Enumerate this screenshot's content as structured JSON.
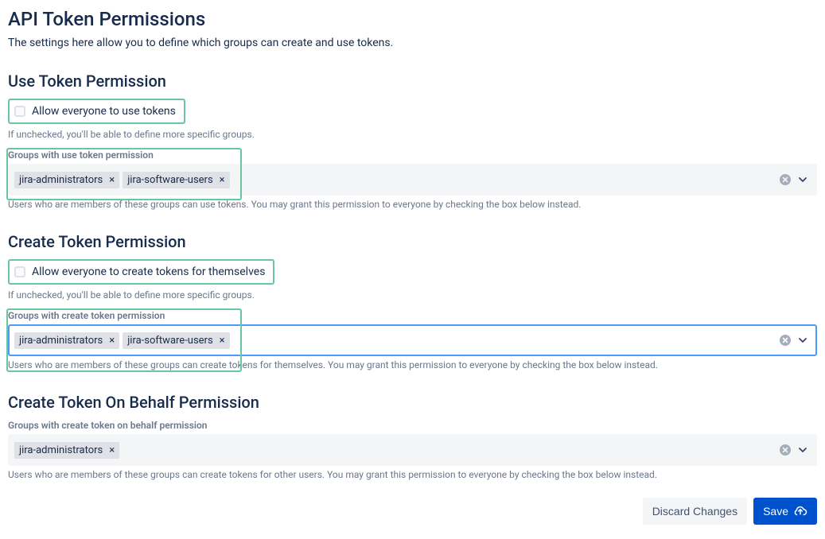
{
  "page": {
    "title": "API Token Permissions",
    "description": "The settings here allow you to define which groups can create and use tokens."
  },
  "useToken": {
    "heading": "Use Token Permission",
    "checkboxLabel": "Allow everyone to use tokens",
    "checkboxHelp": "If unchecked, you'll be able to define more specific groups.",
    "fieldLabel": "Groups with use token permission",
    "tags": [
      "jira-administrators",
      "jira-software-users"
    ],
    "fieldHelp": "Users who are members of these groups can use tokens. You may grant this permission to everyone by checking the box below instead."
  },
  "createToken": {
    "heading": "Create Token Permission",
    "checkboxLabel": "Allow everyone to create tokens for themselves",
    "checkboxHelp": "If unchecked, you'll be able to define more specific groups.",
    "fieldLabel": "Groups with create token permission",
    "tags": [
      "jira-administrators",
      "jira-software-users"
    ],
    "fieldHelp": "Users who are members of these groups can create tokens for themselves. You may grant this permission to everyone by checking the box below instead."
  },
  "createOnBehalf": {
    "heading": "Create Token On Behalf Permission",
    "fieldLabel": "Groups with create token on behalf permission",
    "tags": [
      "jira-administrators"
    ],
    "fieldHelp": "Users who are members of these groups can create tokens for other users. You may grant this permission to everyone by checking the box below instead."
  },
  "footer": {
    "discard": "Discard Changes",
    "save": "Save"
  }
}
